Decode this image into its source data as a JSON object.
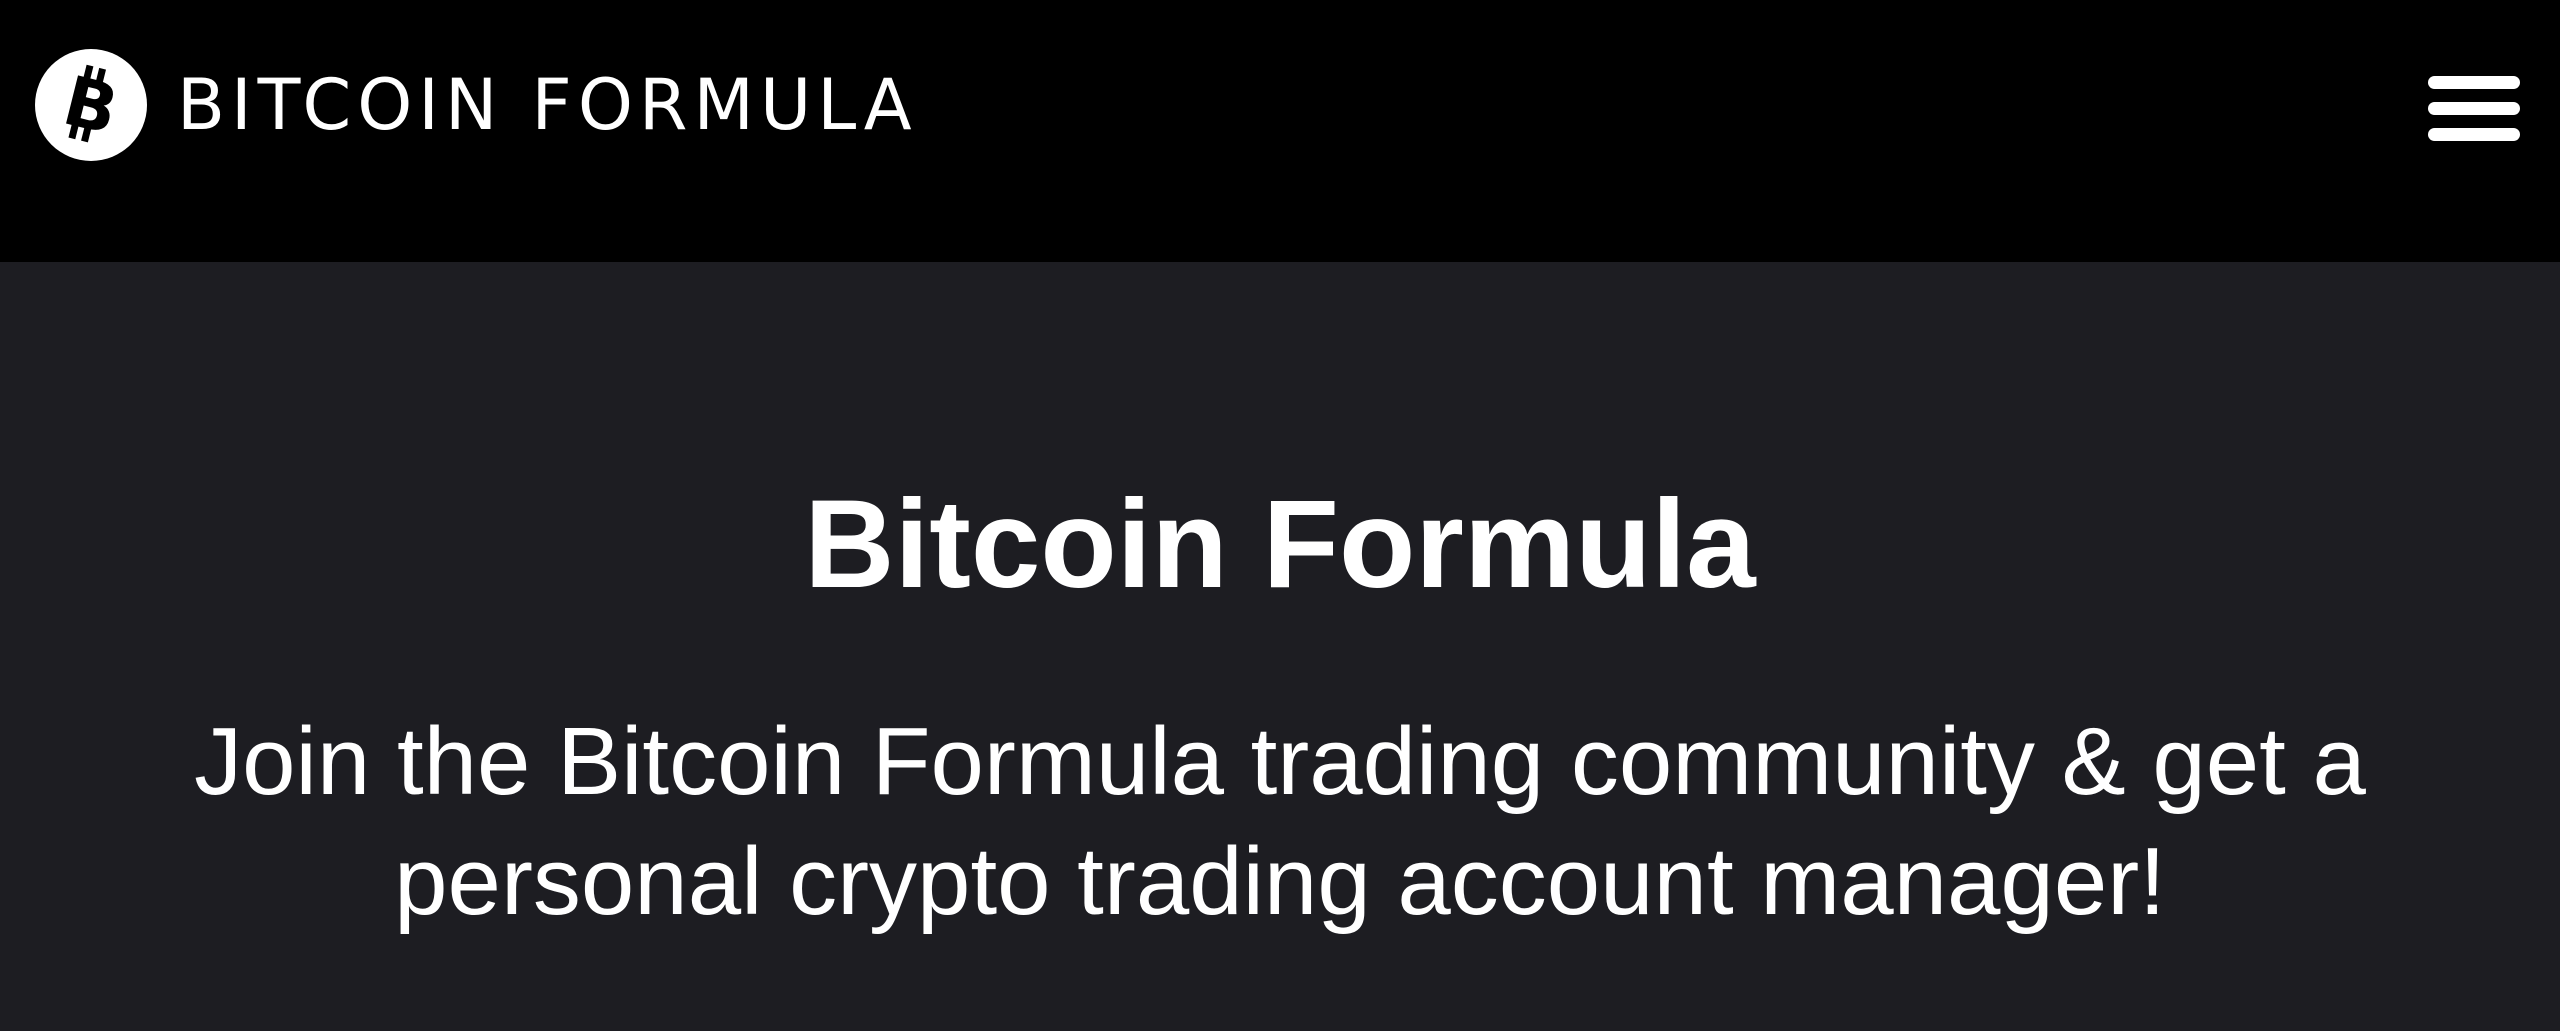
{
  "header": {
    "brand_name": "BITCOIN FORMULA",
    "logo_icon": "bitcoin-logo-icon",
    "menu_icon": "hamburger-menu-icon",
    "background_color": "#000000"
  },
  "hero": {
    "title": "Bitcoin Formula",
    "subtitle": "Join the Bitcoin Formula trading community & get a personal crypto trading account manager!",
    "background_color": "#1d1d22",
    "text_color": "#ffffff"
  }
}
